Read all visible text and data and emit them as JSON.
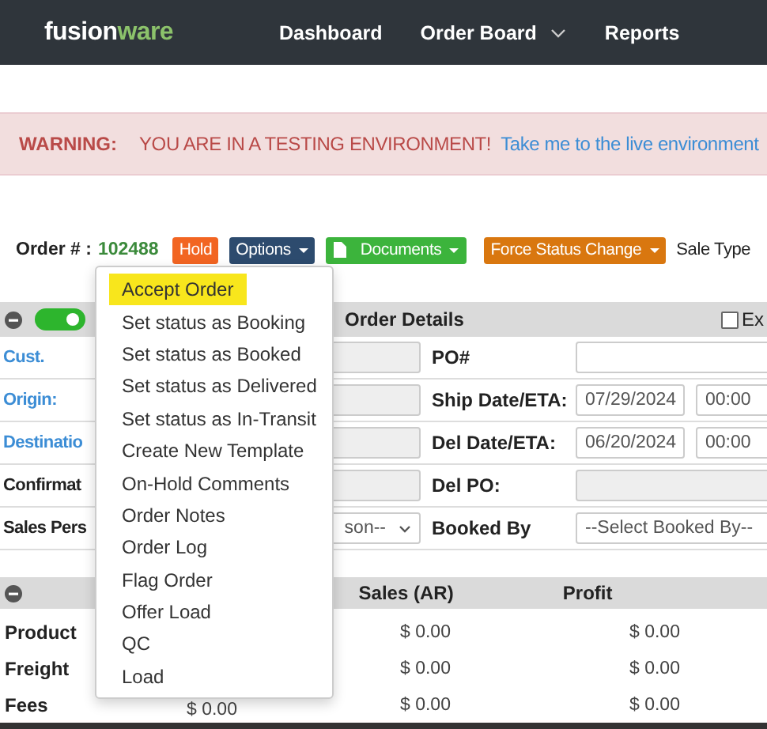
{
  "navbar": {
    "logo": {
      "part_1": "fusion",
      "part_2": "ware"
    },
    "links": [
      {
        "label": "Dashboard",
        "dropdown": false
      },
      {
        "label": "Order Board",
        "dropdown": true
      },
      {
        "label": "Reports",
        "dropdown": false
      }
    ]
  },
  "warning": {
    "label": "WARNING:",
    "message": "YOU ARE IN A TESTING ENVIRONMENT!",
    "link": "Take me to the live environment"
  },
  "order_bar": {
    "label": "Order # :",
    "number": "102488",
    "buttons": [
      {
        "label": "Hold",
        "color": "#f26522",
        "dropdown": false,
        "icon": false
      },
      {
        "label": "Options",
        "color": "#2d4b6e",
        "dropdown": true,
        "icon": false
      },
      {
        "label": "Documents",
        "color": "#3cb43c",
        "dropdown": true,
        "icon": true
      },
      {
        "label": "Force Status Change",
        "color": "#d9770f",
        "dropdown": true,
        "icon": false
      }
    ],
    "sale_type": "Sale Type"
  },
  "order_details": {
    "toggle_on": true,
    "title": "Order Details",
    "export_checkbox": {
      "label": "Ex",
      "checked": false
    },
    "rows": [
      {
        "label": "Cust.",
        "link": true,
        "field": {
          "kind": "text",
          "disabled": true
        },
        "right_label": "PO#",
        "right_fields": [
          {
            "kind": "text",
            "disabled": false
          }
        ]
      },
      {
        "label": "Origin:",
        "link": true,
        "field": {
          "kind": "text",
          "disabled": true
        },
        "right_label": "Ship Date/ETA:",
        "right_fields": [
          {
            "kind": "date",
            "value": "07/29/2024",
            "disabled": false
          },
          {
            "kind": "time",
            "value": "00:00",
            "disabled": false
          }
        ]
      },
      {
        "label": "Destinatio",
        "link": true,
        "field": {
          "kind": "text",
          "disabled": true
        },
        "right_label": "Del Date/ETA:",
        "right_fields": [
          {
            "kind": "date",
            "value": "06/20/2024",
            "disabled": false
          },
          {
            "kind": "time",
            "value": "00:00",
            "disabled": false
          }
        ]
      },
      {
        "label": "Confirmat",
        "link": false,
        "field": {
          "kind": "text",
          "disabled": true
        },
        "right_label": "Del PO:",
        "right_fields": [
          {
            "kind": "text",
            "disabled": true
          }
        ]
      },
      {
        "label": "Sales Pers",
        "link": false,
        "field": {
          "kind": "select",
          "value": "son--",
          "disabled": false
        },
        "right_label": "Booked By",
        "right_fields": [
          {
            "kind": "select",
            "value": "--Select Booked By--",
            "disabled": false
          }
        ]
      }
    ]
  },
  "totals": {
    "columns": [
      "Sales (AR)",
      "Profit"
    ],
    "rows": [
      {
        "label": "Product",
        "sales": "$ 0.00",
        "profit": "$ 0.00"
      },
      {
        "label": "Freight",
        "sales": "$ 0.00",
        "profit": "$ 0.00"
      },
      {
        "label": "Fees",
        "column_1": "$ 0.00",
        "sales": "$ 0.00",
        "profit": "$ 0.00"
      }
    ]
  },
  "options_menu": {
    "items": [
      {
        "label": "Accept Order",
        "selected": true
      },
      {
        "label": "Set status as Booking",
        "selected": false
      },
      {
        "label": "Set status as Booked",
        "selected": false
      },
      {
        "label": "Set status as Delivered",
        "selected": false
      },
      {
        "label": "Set status as In-Transit",
        "selected": false
      },
      {
        "label": "Create New Template",
        "selected": false
      },
      {
        "label": "On-Hold Comments",
        "selected": false
      },
      {
        "label": "Order Notes",
        "selected": false
      },
      {
        "label": "Order Log",
        "selected": false
      },
      {
        "label": "Flag Order",
        "selected": false
      },
      {
        "label": "Offer Load",
        "selected": false
      },
      {
        "label": "QC",
        "selected": false
      },
      {
        "label": "Load",
        "selected": false
      }
    ]
  }
}
